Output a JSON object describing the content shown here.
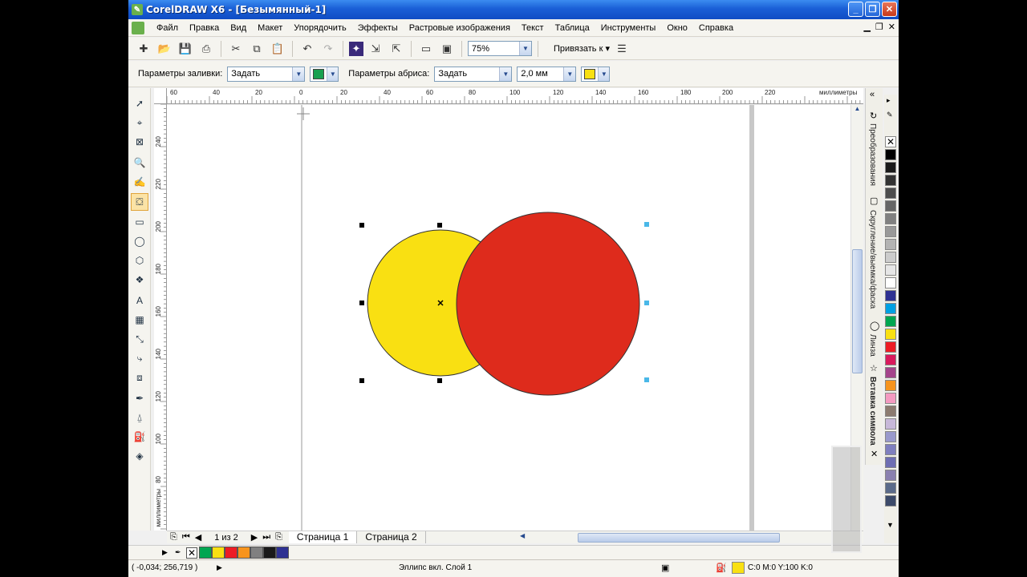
{
  "titlebar": {
    "title": "CorelDRAW X6 - [Безымянный-1]"
  },
  "menu": [
    "Файл",
    "Правка",
    "Вид",
    "Макет",
    "Упорядочить",
    "Эффекты",
    "Растровые изображения",
    "Текст",
    "Таблица",
    "Инструменты",
    "Окно",
    "Справка"
  ],
  "toolbar": {
    "zoom": "75%",
    "snap_label": "Привязать к"
  },
  "propbar": {
    "fill_label": "Параметры заливки:",
    "fill_value": "Задать",
    "fill_color": "#18a050",
    "outline_label": "Параметры абриса:",
    "outline_value": "Задать",
    "outline_width": "2,0 мм",
    "outline_color": "#f9e012"
  },
  "ruler": {
    "h_labels": [
      "60",
      "40",
      "20",
      "0",
      "20",
      "40",
      "60",
      "80",
      "100",
      "120",
      "140",
      "160",
      "180",
      "200",
      "220"
    ],
    "h_unit": "миллиметры",
    "v_labels": [
      "240",
      "220",
      "200",
      "180",
      "160",
      "140",
      "120",
      "100",
      "80"
    ],
    "v_unit": "миллиметры"
  },
  "shapes": {
    "yellow_circle_color": "#f9e012",
    "red_circle_color": "#de2b1c"
  },
  "pagenav": {
    "counter": "1 из 2",
    "pages": [
      "Страница 1",
      "Страница 2"
    ]
  },
  "dockers": [
    "Преобразования",
    "Скругление/выемка/фаска",
    "Линза",
    "Вставка символа"
  ],
  "palette_colors": [
    "#000000",
    "#1a1a1a",
    "#333333",
    "#4d4d4d",
    "#666666",
    "#808080",
    "#999999",
    "#b3b3b3",
    "#cccccc",
    "#e6e6e6",
    "#ffffff",
    "#2e3192",
    "#00a0e3",
    "#00a651",
    "#f9e012",
    "#ed1c24",
    "#d91a5d",
    "#a4448b",
    "#f7941d",
    "#f49ac1",
    "#8c7b70",
    "#c7b8d9",
    "#9999cc",
    "#7f7fbf",
    "#6e6eb3",
    "#8a80b0",
    "#5a6a8a",
    "#3c4a6a"
  ],
  "doc_palette": [
    "#00a651",
    "#f9e012",
    "#ed1c24",
    "#f7941d",
    "#808080",
    "#1a1a1a",
    "#2e3192"
  ],
  "status": {
    "coords": "( -0,034; 256,719 )",
    "object": "Эллипс вкл. Слой 1",
    "fill_color": "#f9e012",
    "fill_value": "C:0 M:0 Y:100 K:0"
  }
}
